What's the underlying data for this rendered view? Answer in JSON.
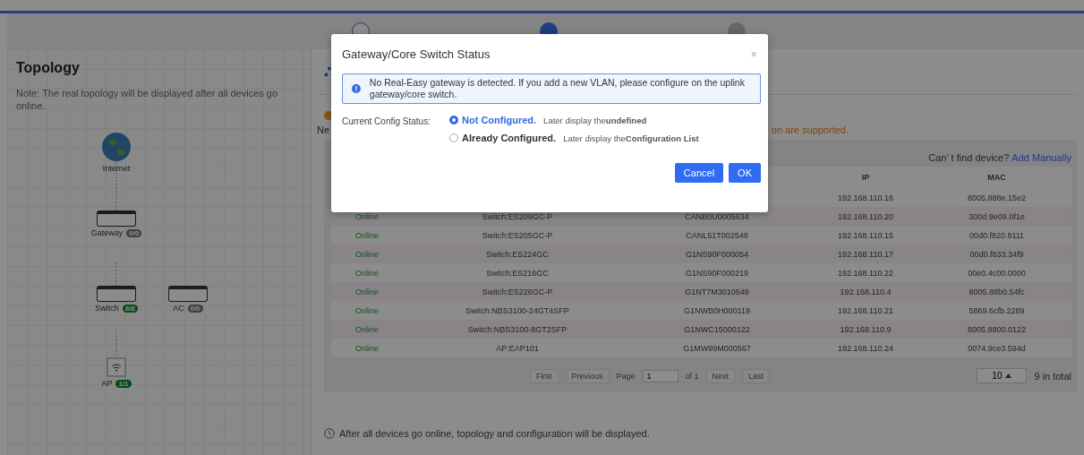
{
  "topology": {
    "title": "Topology",
    "note": "Note: The real topology will be displayed after all devices go online.",
    "nodes": [
      {
        "kind": "globe",
        "label": "Internet"
      },
      {
        "kind": "device",
        "label": "Gateway",
        "badge": "0/0",
        "active": false
      },
      {
        "kind": "device",
        "label": "Switch",
        "badge": "8/8",
        "active": true
      },
      {
        "kind": "device",
        "label": "AC",
        "badge": "0/0",
        "active": false
      },
      {
        "kind": "ap",
        "label": "AP",
        "badge": "1/1",
        "active": true
      }
    ]
  },
  "main": {
    "network_text_fragment": "Ne",
    "warning_fragment": "on are supported.",
    "find_prompt": "Can’ t find device?",
    "add_link": "Add Manually",
    "columns": [
      "IP",
      "MAC"
    ],
    "rows": [
      {
        "ip": "192.168.110.16",
        "mac": "8005.888e.15e2"
      },
      {
        "status": "Online",
        "model": "Switch:ES209GC-P",
        "sn": "CANB0U0005634",
        "ip": "192.168.110.20",
        "mac": "300d.9e09.0f1e"
      },
      {
        "status": "Online",
        "model": "Switch:ES205GC-P",
        "sn": "CANL51T002548",
        "ip": "192.168.110.15",
        "mac": "00d0.f820.9111"
      },
      {
        "status": "Online",
        "model": "Switch:ES224GC",
        "sn": "G1NS90F000054",
        "ip": "192.168.110.17",
        "mac": "00d0.f833.34f9"
      },
      {
        "status": "Online",
        "model": "Switch:ES216GC",
        "sn": "G1NS90F000219",
        "ip": "192.168.110.22",
        "mac": "00e0.4c00.0000"
      },
      {
        "status": "Online",
        "model": "Switch:ES226GC-P",
        "sn": "G1NT7M3010548",
        "ip": "192.168.110.4",
        "mac": "8005.88b0.54fc"
      },
      {
        "status": "Online",
        "model": "Switch:NBS3100-24GT4SFP",
        "sn": "G1NWB0H000119",
        "ip": "192.168.110.21",
        "mac": "5869.6cfb.2289"
      },
      {
        "status": "Online",
        "model": "Switch:NBS3100-8GT2SFP",
        "sn": "G1NWC15000122",
        "ip": "192.168.110.9",
        "mac": "8005.8800.0122"
      },
      {
        "status": "Online",
        "model": "AP:EAP101",
        "sn": "G1MW99M000567",
        "ip": "192.168.110.24",
        "mac": "0074.9ce3.594d"
      }
    ],
    "pagination": {
      "first": "First",
      "previous": "Previous",
      "page_label": "Page",
      "page": "1",
      "of": "of 1",
      "next": "Next",
      "last": "Last",
      "page_size": "10",
      "total": "9 in total"
    },
    "footer_note": "After all devices go online, topology and configuration will be displayed."
  },
  "dialog": {
    "title": "Gateway/Core Switch Status",
    "close": "×",
    "alert": "No Real-Easy gateway is detected. If you add a new VLAN, please configure on the uplink gateway/core switch.",
    "status_label": "Current Config Status:",
    "options": [
      {
        "label": "Not Configured.",
        "hint": "Later display the**undefined**",
        "selected": true
      },
      {
        "label": "Already Configured.",
        "hint": "Later display the**Configuration List**",
        "selected": false
      }
    ],
    "buttons": [
      {
        "label": "Cancel",
        "kind": "primary"
      },
      {
        "label": "OK",
        "kind": "primary"
      }
    ]
  }
}
